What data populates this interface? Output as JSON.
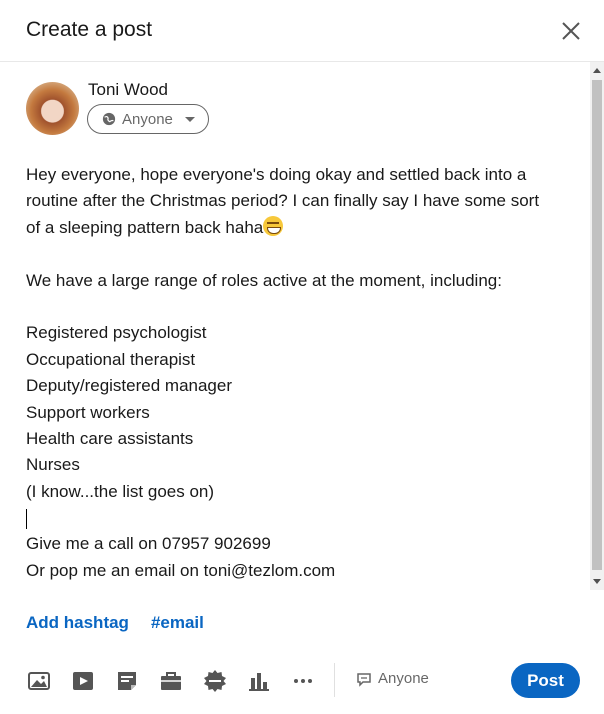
{
  "dialog": {
    "title": "Create a post"
  },
  "author": {
    "name": "Toni Wood"
  },
  "audience": {
    "label": "Anyone"
  },
  "post": {
    "lines": [
      "Hey everyone, hope everyone's doing okay and settled back into a",
      "routine after the Christmas period? I can finally say I have some sort",
      "of a sleeping pattern back haha",
      "",
      "We have a large range of roles active at the moment, including:",
      "",
      "Registered psychologist",
      "Occupational therapist",
      "Deputy/registered manager",
      "Support workers",
      "Health care assistants",
      "Nurses",
      "(I know...the list goes on)",
      "",
      "Give me a call on 07957 902699",
      "Or pop me an email on toni@tezlom.com"
    ]
  },
  "hashtags": {
    "add_label": "Add hashtag",
    "suggested": "#email"
  },
  "toolbar": {
    "icons": [
      "photo-icon",
      "video-icon",
      "document-icon",
      "job-icon",
      "celebrate-icon",
      "poll-icon",
      "more-icon"
    ],
    "comment_audience": "Anyone",
    "post_label": "Post"
  },
  "colors": {
    "accent": "#0a66c2",
    "text": "#191919",
    "muted": "#666666"
  }
}
